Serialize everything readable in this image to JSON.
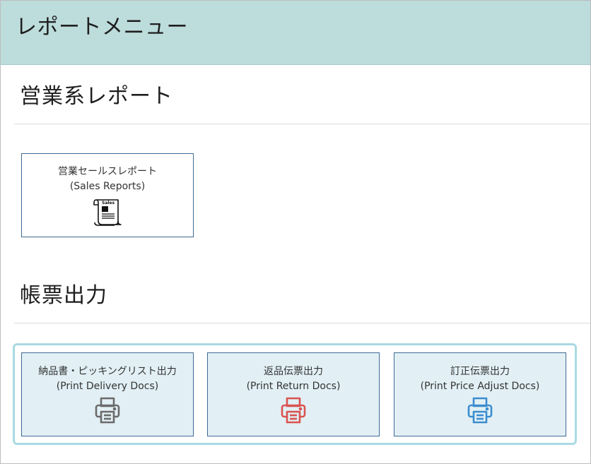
{
  "header": {
    "title": "レポートメニュー"
  },
  "sections": [
    {
      "title": "営業系レポート",
      "cards": [
        {
          "title": "営業セールスレポート",
          "subtitle": "(Sales Reports)",
          "icon": "sales-report-scroll-icon",
          "icon_label": "Sales"
        }
      ]
    },
    {
      "title": "帳票出力",
      "cards": [
        {
          "title": "納品書・ピッキングリスト出力",
          "subtitle": "(Print Delivery Docs)",
          "icon": "printer-icon",
          "icon_color": "#6b6b6b"
        },
        {
          "title": "返品伝票出力",
          "subtitle": "(Print Return Docs)",
          "icon": "printer-icon",
          "icon_color": "#d9534f"
        },
        {
          "title": "訂正伝票出力",
          "subtitle": "(Print Price Adjust Docs)",
          "icon": "printer-icon",
          "icon_color": "#3c8dd0"
        }
      ]
    }
  ],
  "colors": {
    "header_bg": "#bddcdc",
    "card_border": "#3e6b95",
    "print_card_bg": "#e2f0f5",
    "group_border": "#a9dae3"
  }
}
